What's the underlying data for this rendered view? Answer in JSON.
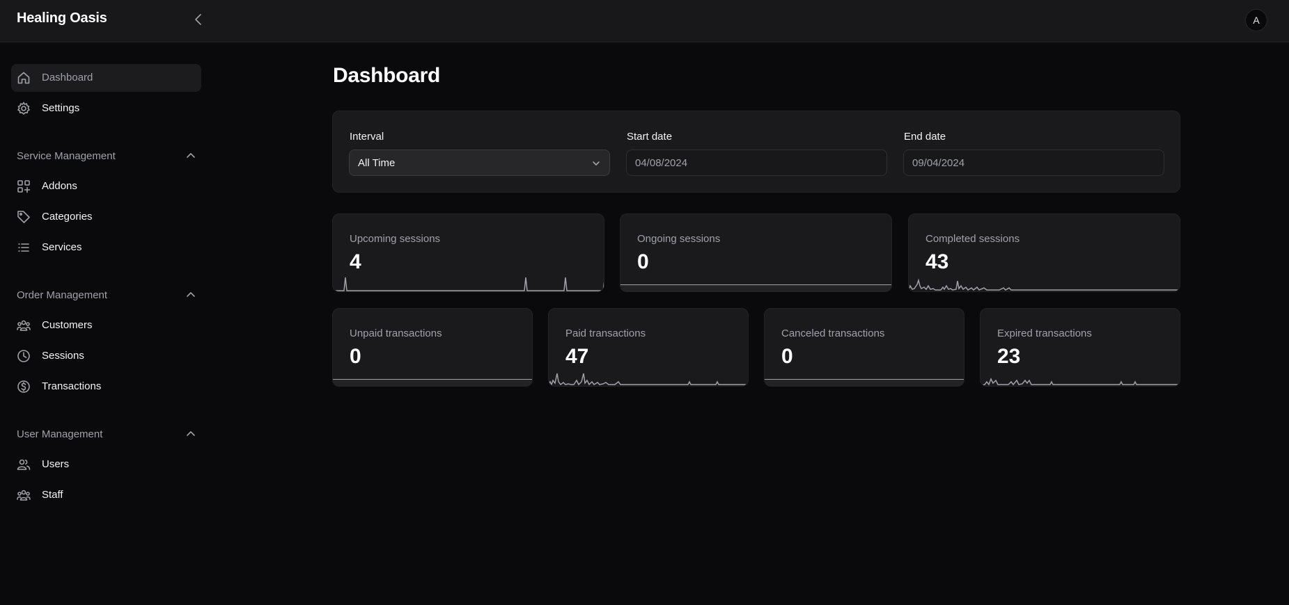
{
  "app": {
    "brand": "Healing Oasis",
    "avatar_initial": "A"
  },
  "sidebar": {
    "top_items": [
      {
        "label": "Dashboard",
        "icon": "home-icon",
        "active": true
      },
      {
        "label": "Settings",
        "icon": "gear-icon",
        "active": false
      }
    ],
    "sections": [
      {
        "title": "Service Management",
        "items": [
          {
            "label": "Addons",
            "icon": "grid-plus-icon"
          },
          {
            "label": "Categories",
            "icon": "tag-icon"
          },
          {
            "label": "Services",
            "icon": "list-icon"
          }
        ]
      },
      {
        "title": "Order Management",
        "items": [
          {
            "label": "Customers",
            "icon": "users-group-icon"
          },
          {
            "label": "Sessions",
            "icon": "clock-icon"
          },
          {
            "label": "Transactions",
            "icon": "dollar-circle-icon"
          }
        ]
      },
      {
        "title": "User Management",
        "items": [
          {
            "label": "Users",
            "icon": "users-icon"
          },
          {
            "label": "Staff",
            "icon": "users-group-icon"
          }
        ]
      }
    ]
  },
  "main": {
    "title": "Dashboard",
    "filters": {
      "interval_label": "Interval",
      "interval_value": "All Time",
      "start_label": "Start date",
      "start_value": "04/08/2024",
      "end_label": "End date",
      "end_value": "09/04/2024"
    },
    "stats": [
      {
        "label": "Upcoming sessions",
        "value": "4"
      },
      {
        "label": "Ongoing sessions",
        "value": "0"
      },
      {
        "label": "Completed sessions",
        "value": "43"
      },
      {
        "label": "Unpaid transactions",
        "value": "0"
      },
      {
        "label": "Paid transactions",
        "value": "47"
      },
      {
        "label": "Canceled transactions",
        "value": "0"
      },
      {
        "label": "Expired transactions",
        "value": "23"
      }
    ]
  },
  "colors": {
    "background": "#0a0a0c",
    "card": "#1a1a1d",
    "muted_text": "#a1a1aa",
    "sparkline": "#a1a1aa"
  }
}
